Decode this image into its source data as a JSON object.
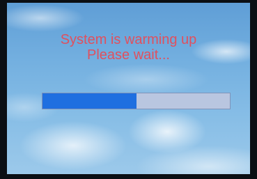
{
  "message": {
    "line1": "System is warming up",
    "line2": "Please wait..."
  },
  "progress": {
    "fraction": 0.5,
    "fill_color": "#1f6fe0",
    "track_color": "#b9c6e0"
  },
  "colors": {
    "text": "#e0505e",
    "sky": "#74b0e0"
  }
}
